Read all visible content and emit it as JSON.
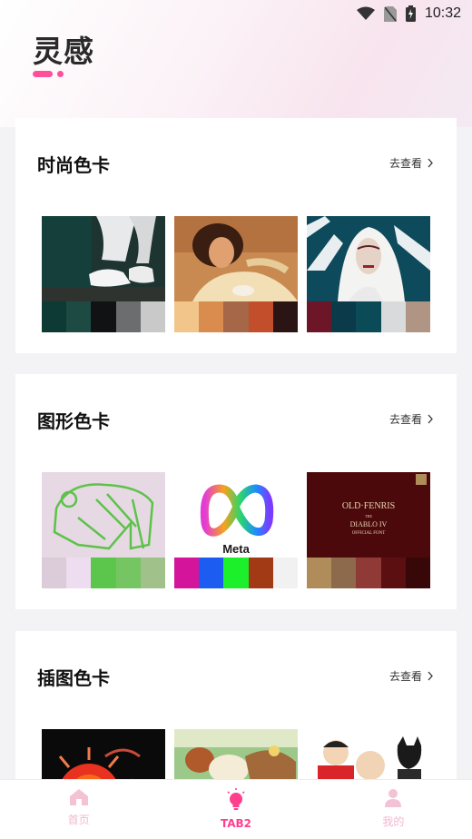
{
  "status": {
    "time": "10:32",
    "icons": [
      "wifi-icon",
      "no-sim-icon",
      "battery-charging-icon"
    ]
  },
  "header": {
    "title": "灵感"
  },
  "sections": [
    {
      "title": "时尚色卡",
      "more": "去查看",
      "tiles": [
        {
          "image": "sneakers-photo",
          "palette": [
            "#0e3a36",
            "#1e4a44",
            "#101213",
            "#6b6d6e",
            "#c9c9c9"
          ]
        },
        {
          "image": "woman-portrait-photo",
          "palette": [
            "#f2c58a",
            "#d98c4d",
            "#a56748",
            "#c24e2b",
            "#2a1414"
          ]
        },
        {
          "image": "white-hood-fashion-photo",
          "palette": [
            "#6d1628",
            "#0b3a4a",
            "#0b4b57",
            "#d8dadb",
            "#b09484"
          ]
        }
      ]
    },
    {
      "title": "图形色卡",
      "more": "去查看",
      "tiles": [
        {
          "image": "line-art-illustration",
          "palette": [
            "#dccbd8",
            "#eedcf0",
            "#5cc54b",
            "#76c563",
            "#a0c28a"
          ]
        },
        {
          "image": "meta-logo",
          "logo_text": "Meta",
          "palette": [
            "#d4159c",
            "#1d5cf0",
            "#1cf02a",
            "#a33a16",
            "#f1f1f1"
          ]
        },
        {
          "image": "diablo-font-poster",
          "poster_lines": [
            "OLD·FENRIS",
            "THE",
            "DIABLO IV",
            "OFFICIAL FONT"
          ],
          "palette": [
            "#b08c5a",
            "#8e6a4c",
            "#8f3a36",
            "#5c0f10",
            "#380708"
          ]
        }
      ]
    },
    {
      "title": "插图色卡",
      "more": "去查看",
      "tiles": [
        {
          "image": "dark-sun-illustration",
          "palette": []
        },
        {
          "image": "animal-cartoon-illustration",
          "palette": []
        },
        {
          "image": "superhero-kids-illustration",
          "palette": []
        }
      ]
    }
  ],
  "tabbar": {
    "items": [
      {
        "label": "首页",
        "icon": "home-icon",
        "active": false
      },
      {
        "label": "TAB2",
        "icon": "lightbulb-icon",
        "active": true
      },
      {
        "label": "我的",
        "icon": "person-icon",
        "active": false
      }
    ]
  },
  "colors": {
    "accent": "#ff3f8e",
    "inactive_tab": "#f1b8cf"
  }
}
